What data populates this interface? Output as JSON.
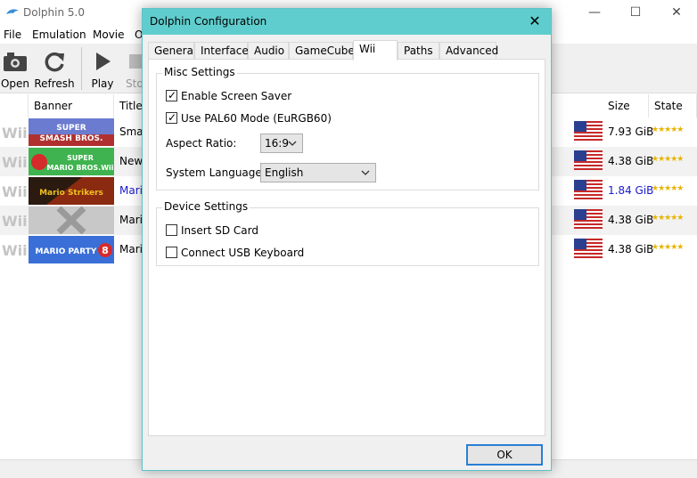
{
  "main": {
    "title": "Dolphin 5.0",
    "menu": [
      "File",
      "Emulation",
      "Movie",
      "O"
    ],
    "toolbar": {
      "open": "Open",
      "refresh": "Refresh",
      "play": "Play",
      "stop": "Sto"
    },
    "columns": {
      "banner": "Banner",
      "title": "Title",
      "size": "Size",
      "state": "State"
    },
    "platform_label": "Wii",
    "games": [
      {
        "title": "Smas",
        "size": "7.93 GiB",
        "stars": "★★★★★",
        "banner_text": "SUPER SMASH BROS. BRAWL"
      },
      {
        "title": "New",
        "size": "4.38 GiB",
        "stars": "★★★★★",
        "banner_text": "NEW SUPER MARIO BROS. Wii"
      },
      {
        "title": "Mari",
        "size": "1.84 GiB",
        "stars": "★★★★★",
        "banner_text": "MARIO STRIKERS CHARGED"
      },
      {
        "title": "Mari",
        "size": "4.38 GiB",
        "stars": "★★★★★",
        "banner_text": ""
      },
      {
        "title": "Mari",
        "size": "4.38 GiB",
        "stars": "★★★★★",
        "banner_text": "MARIO PARTY 8"
      }
    ],
    "highlight_color": "#1a1ad0"
  },
  "dialog": {
    "title": "Dolphin Configuration",
    "tabs": [
      "General",
      "Interface",
      "Audio",
      "GameCube",
      "Wii",
      "Paths",
      "Advanced"
    ],
    "active_tab": "Wii",
    "misc": {
      "title": "Misc Settings",
      "screen_saver": "Enable Screen Saver",
      "screen_saver_checked": true,
      "pal60": "Use PAL60 Mode (EuRGB60)",
      "pal60_checked": true,
      "aspect_label": "Aspect Ratio:",
      "aspect_value": "16:9",
      "lang_label": "System Language:",
      "lang_value": "English"
    },
    "device": {
      "title": "Device Settings",
      "sd": "Insert SD Card",
      "sd_checked": false,
      "usb_kb": "Connect USB Keyboard",
      "usb_kb_checked": false
    },
    "ok": "OK",
    "accent": "#5fcdcd"
  }
}
